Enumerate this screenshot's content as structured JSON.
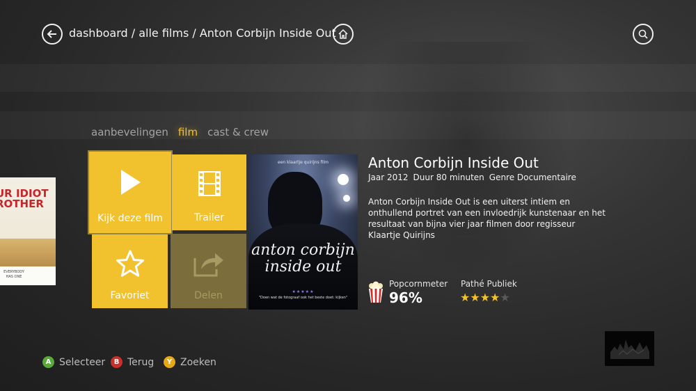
{
  "header": {
    "breadcrumb": "dashboard / alle films / Anton Corbijn Inside Out",
    "back_icon": "arrow-left-icon",
    "home_icon": "home-icon",
    "search_icon": "search-icon"
  },
  "tabs": [
    {
      "label": "aanbevelingen",
      "active": false
    },
    {
      "label": "film",
      "active": true
    },
    {
      "label": "cast & crew",
      "active": false
    }
  ],
  "peek_poster": {
    "title": "UR IDIOT\nROTHER",
    "tagline": "EVERYBODY\nHAS ONE"
  },
  "actions": {
    "watch": {
      "label": "Kijk deze film",
      "icon": "play-icon"
    },
    "trailer": {
      "label": "Trailer",
      "icon": "film-strip-icon"
    },
    "favorite": {
      "label": "Favoriet",
      "icon": "star-icon"
    },
    "share": {
      "label": "Delen",
      "icon": "share-icon",
      "enabled": false
    }
  },
  "poster": {
    "top_text": "een klaartje quirijns film",
    "title": "anton corbijn\ninside out",
    "stars": "★★★★★",
    "quote": "\"Doen wat de fotograaf ook het beste doet: kijken\""
  },
  "movie": {
    "title": "Anton Corbijn Inside Out",
    "year": "Jaar 2012",
    "duration": "Duur 80 minuten",
    "genre": "Genre Documentaire",
    "description": "Anton Corbijn Inside Out is een uiterst intiem en onthullend portret van een invloedrijk kunstenaar en het resultaat van bijna vier jaar filmen door regisseur Klaartje Quirijns"
  },
  "ratings": {
    "popcornmeter_label": "Popcornmeter",
    "popcornmeter_value": "96%",
    "pathe_label": "Pathé Publiek",
    "pathe_stars": 4,
    "pathe_max": 5
  },
  "footer": {
    "hints": [
      {
        "button": "A",
        "label": "Selecteer",
        "color": "#5aa93b"
      },
      {
        "button": "B",
        "label": "Terug",
        "color": "#c9302c"
      },
      {
        "button": "Y",
        "label": "Zoeken",
        "color": "#e6a817"
      }
    ]
  },
  "colors": {
    "accent": "#f2c12e",
    "background": "#2a2a2a"
  }
}
